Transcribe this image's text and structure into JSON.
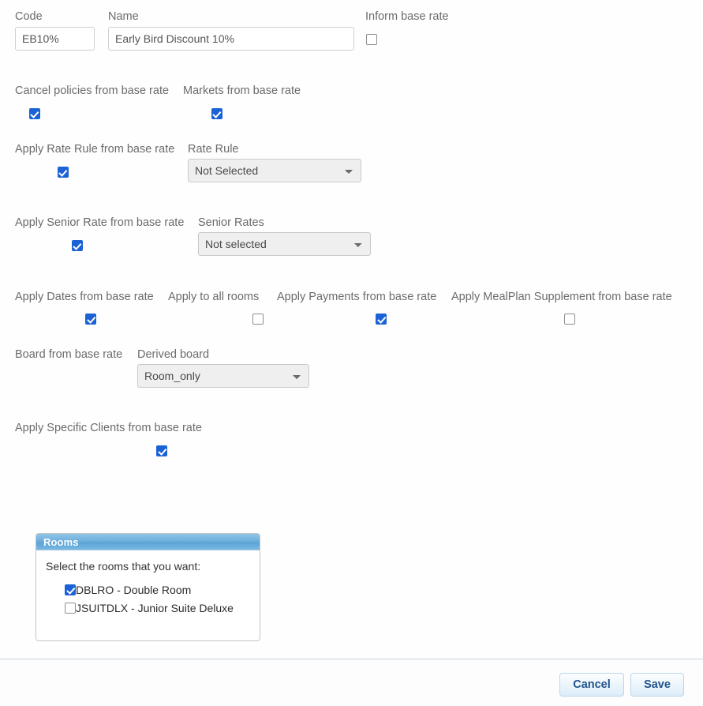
{
  "form": {
    "code": {
      "label": "Code",
      "value": "EB10%"
    },
    "name": {
      "label": "Name",
      "value": "Early Bird Discount 10%"
    },
    "inform_base_rate": {
      "label": "Inform base rate",
      "checked": false
    },
    "cancel_policies": {
      "label": "Cancel policies from base rate",
      "checked": true
    },
    "markets": {
      "label": "Markets from base rate",
      "checked": true
    },
    "apply_rate_rule": {
      "label": "Apply Rate Rule from base rate",
      "checked": true
    },
    "rate_rule": {
      "label": "Rate Rule",
      "value": "Not Selected",
      "options": [
        "Not Selected"
      ]
    },
    "apply_senior_rate": {
      "label": "Apply Senior Rate from base rate",
      "checked": true
    },
    "senior_rates": {
      "label": "Senior Rates",
      "value": "Not selected",
      "options": [
        "Not selected"
      ]
    },
    "apply_dates": {
      "label": "Apply Dates from base rate",
      "checked": true
    },
    "apply_all_rooms": {
      "label": "Apply to all rooms",
      "checked": false
    },
    "apply_payments": {
      "label": "Apply Payments from base rate",
      "checked": true
    },
    "apply_mealplan": {
      "label": "Apply MealPlan Supplement from base rate",
      "checked": false
    },
    "board_from_base_rate": {
      "label": "Board from base rate",
      "checked": true
    },
    "derived_board": {
      "label": "Derived board",
      "value": "Room_only",
      "options": [
        "Room_only"
      ]
    },
    "apply_specific_clients": {
      "label": "Apply Specific Clients from base rate",
      "checked": true
    }
  },
  "rooms_panel": {
    "title": "Rooms",
    "intro": "Select the rooms that you want:",
    "rooms": [
      {
        "label": "DBLRO - Double Room",
        "checked": true
      },
      {
        "label": "JSUITDLX - Junior Suite Deluxe",
        "checked": false
      }
    ]
  },
  "footer": {
    "cancel_label": "Cancel",
    "save_label": "Save"
  },
  "colors": {
    "checkbox_checked": "#1a62d6",
    "panel_header": "#5ba3d6",
    "button_text": "#20538d",
    "label_text": "#6b6b6b"
  }
}
